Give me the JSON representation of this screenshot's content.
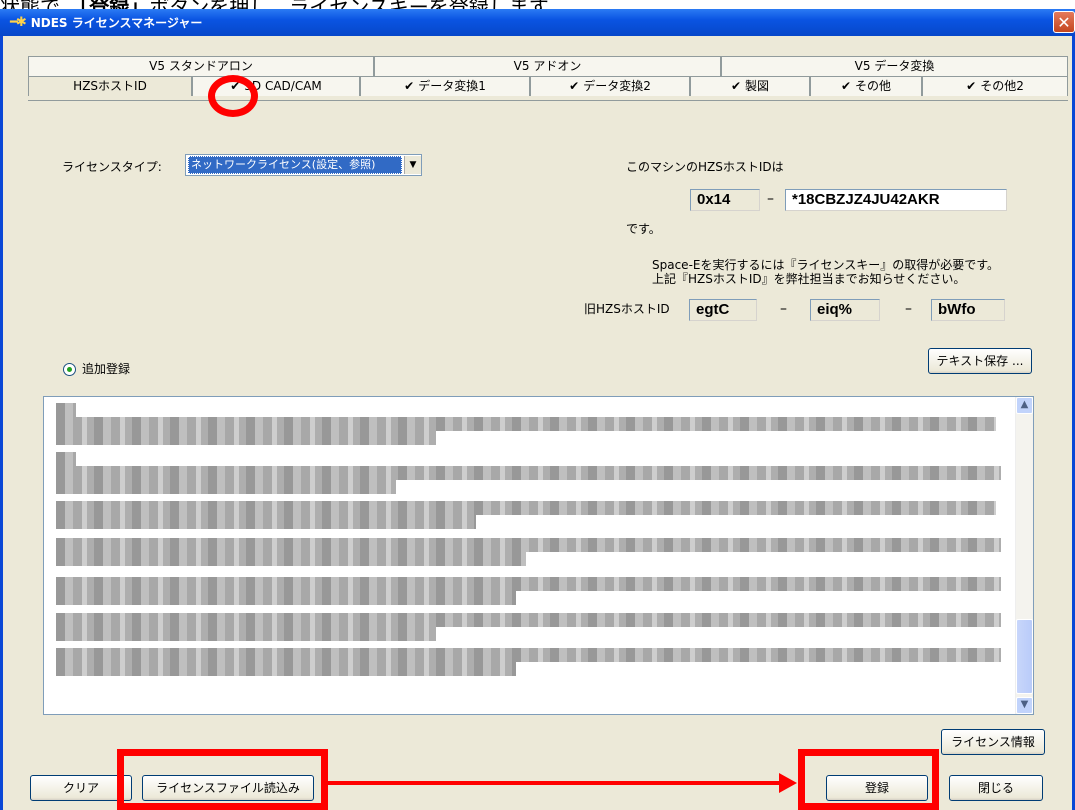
{
  "caption": {
    "pre": "状態で、",
    "bold": "「登録」",
    "post": "ボタンを押し、ライセンスキーを登録します。"
  },
  "window": {
    "title": "NDES ライセンスマネージャー",
    "close_glyph": "✕"
  },
  "tabs_top": [
    "V5 スタンドアロン",
    "V5 アドオン",
    "V5 データ変換"
  ],
  "tabs_bottom": [
    {
      "label": "HZSホストID",
      "check": ""
    },
    {
      "label": "3D CAD/CAM",
      "check": "✔"
    },
    {
      "label": "データ変換1",
      "check": "✔"
    },
    {
      "label": "データ変換2",
      "check": "✔"
    },
    {
      "label": "製図",
      "check": "✔"
    },
    {
      "label": "その他",
      "check": "✔"
    },
    {
      "label": "その他2",
      "check": "✔"
    }
  ],
  "license_type": {
    "label": "ライセンスタイプ:",
    "value": "ネットワークライセンス(設定、参照)"
  },
  "hostid": {
    "intro": "このマシンのHZSホストIDは",
    "prefix": "0x14",
    "dash": "–",
    "id": "*18CBZJZ4JU42AKR",
    "desu": "です。",
    "note1": "Space-Eを実行するには『ライセンスキー』の取得が必要です。",
    "note2": "上記『HZSホストID』を弊社担当までお知らせください。"
  },
  "old_hostid": {
    "label": "旧HZSホストID",
    "v1": "egtC",
    "v2": "eiq%",
    "v3": "bWfo"
  },
  "buttons": {
    "text_save": "テキスト保存 ...",
    "license_info": "ライセンス情報",
    "clear": "クリア",
    "read_file": "ライセンスファイル読込み",
    "register": "登録",
    "close": "閉じる"
  },
  "radio": {
    "label": "追加登録"
  },
  "scroll": {
    "up": "▲",
    "down": "▼"
  }
}
